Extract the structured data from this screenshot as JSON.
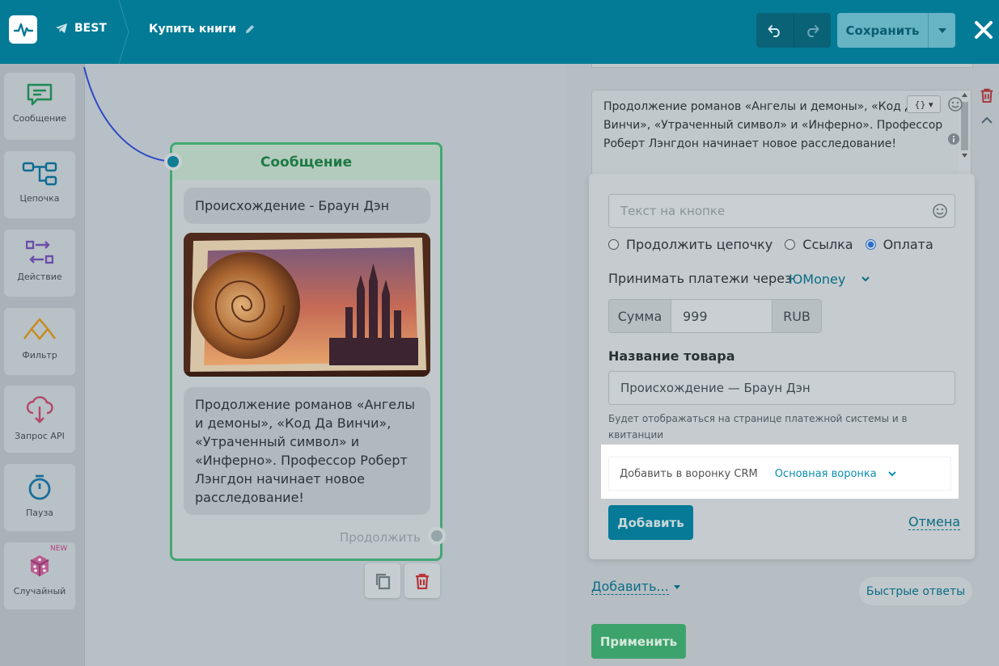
{
  "header": {
    "bot_name": "BEST",
    "flow_title": "Купить книги",
    "save_label": "Сохранить"
  },
  "sidebar": {
    "items": [
      {
        "label": "Сообщение",
        "icon": "message-icon",
        "color": "#1f8a52"
      },
      {
        "label": "Цепочка",
        "icon": "chain-icon",
        "color": "#0c6c94"
      },
      {
        "label": "Действие",
        "icon": "action-icon",
        "color": "#6b4fa8"
      },
      {
        "label": "Фильтр",
        "icon": "filter-icon",
        "color": "#c98a1a"
      },
      {
        "label": "Запрос API",
        "icon": "api-cloud-icon",
        "color": "#b2476a"
      },
      {
        "label": "Пауза",
        "icon": "timer-icon",
        "color": "#1c6e9a"
      },
      {
        "label": "Случайный",
        "icon": "dice-icon",
        "color": "#a64a8a",
        "badge": "NEW"
      }
    ]
  },
  "node": {
    "title": "Сообщение",
    "book_title": "Происхождение - Браун Дэн",
    "description": "Продолжение романов «Ангелы и демоны», «Код Да Винчи», «Утраченный символ» и «Инферно». Профессор Роберт Лэнгдон начинает новое расследование!",
    "continue_label": "Продолжить"
  },
  "editor": {
    "message_text": "Продолжение романов «Ангелы и демоны», «Код Да Винчи», «Утраченный символ» и «Инферно». Профессор Роберт Лэнгдон начинает новое расследование!",
    "var_button": "{}",
    "button_text_placeholder": "Текст на кнопке",
    "radio_options": [
      "Продолжить цепочку",
      "Ссылка",
      "Оплата"
    ],
    "payment_label": "Принимать платежи через",
    "payment_provider": "ЮMoney",
    "amount_label": "Сумма",
    "amount_value": "999",
    "currency": "RUB",
    "product_name_label": "Название товара",
    "product_name_value": "Происхождение — Браун Дэн",
    "product_hint": "Будет отображаться на странице платежной системы и в квитанции",
    "crm_label": "Добавить в воронку CRM",
    "crm_funnel": "Основная воронка",
    "add_button": "Добавить",
    "cancel_link": "Отмена",
    "add_more": "Добавить...",
    "quick_replies": "Быстрые ответы",
    "apply_button": "Применить"
  }
}
